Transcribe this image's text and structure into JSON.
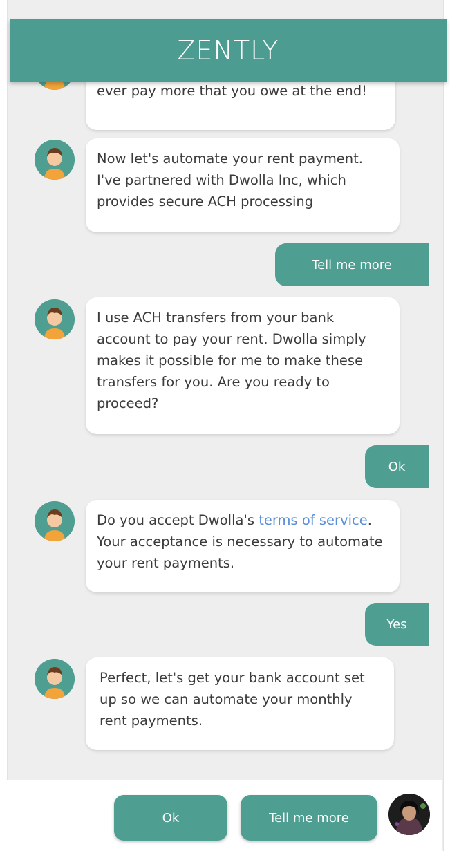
{
  "app": {
    "title": "ZENTLY"
  },
  "messages": [
    {
      "from": "bot",
      "text": "ever pay more that you owe at the end!"
    },
    {
      "from": "bot",
      "text": "Now let's automate your rent payment. I've partnered with Dwolla Inc, which provides secure ACH processing"
    },
    {
      "from": "user",
      "text": "Tell me more"
    },
    {
      "from": "bot",
      "text": "I use ACH transfers from your bank account to pay your rent. Dwolla simply makes it possible for me to make these transfers for you. Are you ready to proceed?"
    },
    {
      "from": "user",
      "text": "Ok"
    },
    {
      "from": "bot",
      "text_before": "Do you accept Dwolla's ",
      "link": "terms of service",
      "text_after": ". Your acceptance is necessary to automate your rent payments."
    },
    {
      "from": "user",
      "text": "Yes"
    },
    {
      "from": "bot",
      "text": "Perfect, let's get your bank account set up so we can automate your monthly rent payments."
    }
  ],
  "quick_replies": [
    "Ok",
    "Tell me more"
  ],
  "icons": {
    "bot_avatar": "bot-avatar-icon",
    "user_avatar": "user-avatar"
  },
  "colors": {
    "accent": "#4e9e92",
    "background": "#eeeeee",
    "link": "#5a8fd6"
  }
}
